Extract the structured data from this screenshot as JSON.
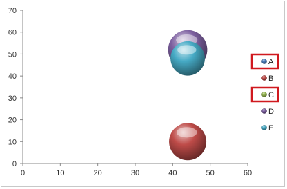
{
  "chart_data": {
    "type": "bubble",
    "title": "",
    "xlabel": "",
    "ylabel": "",
    "xlim": [
      0,
      60
    ],
    "ylim": [
      0,
      70
    ],
    "xticks": [
      0,
      10,
      20,
      30,
      40,
      50,
      60
    ],
    "yticks": [
      0,
      10,
      20,
      30,
      40,
      50,
      60,
      70
    ],
    "grid": false,
    "legend_position": "right",
    "series": [
      {
        "name": "A",
        "color": "#4a7ebb",
        "points": []
      },
      {
        "name": "B",
        "color": "#be4b48",
        "points": [
          {
            "x": 44,
            "y": 10,
            "size": 1.0
          }
        ]
      },
      {
        "name": "C",
        "color": "#98b954",
        "points": []
      },
      {
        "name": "D",
        "color": "#7d60a0",
        "points": [
          {
            "x": 44,
            "y": 52,
            "size": 1.1
          }
        ]
      },
      {
        "name": "E",
        "color": "#46aac5",
        "points": [
          {
            "x": 44,
            "y": 48,
            "size": 0.85
          }
        ]
      }
    ],
    "highlighted_legend_entries": [
      "A",
      "C"
    ],
    "highlight_color": "#d0191f"
  }
}
